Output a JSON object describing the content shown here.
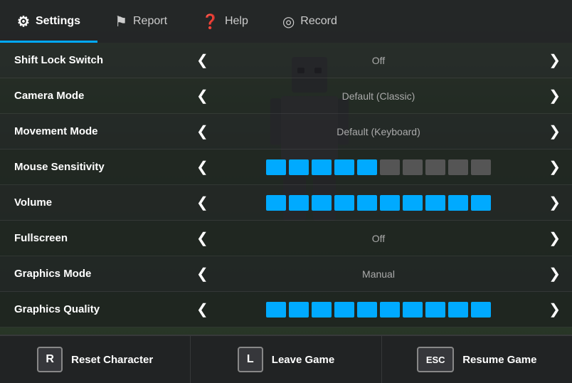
{
  "nav": {
    "items": [
      {
        "id": "settings",
        "label": "Settings",
        "icon": "⚙",
        "active": true
      },
      {
        "id": "report",
        "label": "Report",
        "icon": "⚑",
        "active": false
      },
      {
        "id": "help",
        "label": "Help",
        "icon": "?",
        "active": false
      },
      {
        "id": "record",
        "label": "Record",
        "icon": "◎",
        "active": false
      }
    ]
  },
  "settings": [
    {
      "id": "shift-lock",
      "label": "Shift Lock Switch",
      "type": "value",
      "value": "Off"
    },
    {
      "id": "camera-mode",
      "label": "Camera Mode",
      "type": "value",
      "value": "Default (Classic)"
    },
    {
      "id": "movement-mode",
      "label": "Movement Mode",
      "type": "value",
      "value": "Default (Keyboard)"
    },
    {
      "id": "mouse-sensitivity",
      "label": "Mouse Sensitivity",
      "type": "slider",
      "filled": 5,
      "total": 10
    },
    {
      "id": "volume",
      "label": "Volume",
      "type": "slider",
      "filled": 10,
      "total": 10
    },
    {
      "id": "fullscreen",
      "label": "Fullscreen",
      "type": "value",
      "value": "Off"
    },
    {
      "id": "graphics-mode",
      "label": "Graphics Mode",
      "type": "value",
      "value": "Manual"
    },
    {
      "id": "graphics-quality",
      "label": "Graphics Quality",
      "type": "slider",
      "filled": 10,
      "total": 10
    }
  ],
  "bottomBar": {
    "buttons": [
      {
        "id": "reset",
        "key": "R",
        "label": "Reset Character"
      },
      {
        "id": "leave",
        "key": "L",
        "label": "Leave Game"
      },
      {
        "id": "resume",
        "key": "ESC",
        "label": "Resume Game"
      }
    ]
  },
  "icons": {
    "left_arrow": "❮",
    "right_arrow": "❯",
    "settings": "⚙",
    "report": "⚑",
    "help": "❓",
    "record": "◎"
  }
}
